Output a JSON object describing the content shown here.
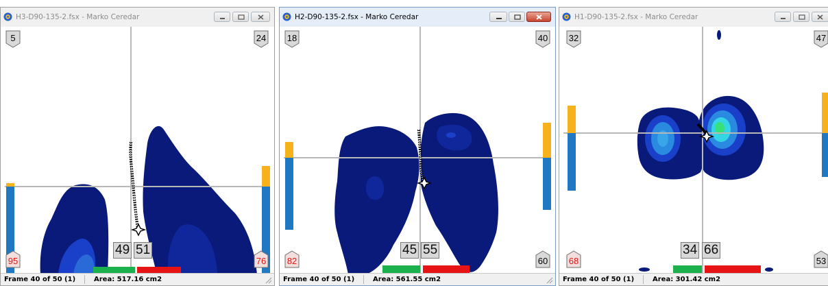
{
  "windows": [
    {
      "title": "H3-D90-135-2.fsx - Marko  Ceredar",
      "corners": {
        "top_left": "5",
        "top_right": "24",
        "bottom_left": "95",
        "bottom_right": "76"
      },
      "split": {
        "left": "49",
        "right": "51"
      },
      "status": {
        "frame": "Frame 40 of 50 (1)",
        "area": "Area: 517.16 cm2"
      }
    },
    {
      "title": "H2-D90-135-2.fsx - Marko Ceredar",
      "corners": {
        "top_left": "18",
        "top_right": "40",
        "bottom_left": "82",
        "bottom_right": "60"
      },
      "split": {
        "left": "45",
        "right": "55"
      },
      "status": {
        "frame": "Frame 40 of 50 (1)",
        "area": "Area: 561.55 cm2"
      }
    },
    {
      "title": "H1-D90-135-2.fsx - Marko  Ceredar",
      "corners": {
        "top_left": "32",
        "top_right": "47",
        "bottom_left": "68",
        "bottom_right": "53"
      },
      "split": {
        "left": "34",
        "right": "66"
      },
      "status": {
        "frame": "Frame 40 of 50 (1)",
        "area": "Area: 301.42 cm2"
      }
    }
  ],
  "colors": {
    "pressure_dark": "#0a1a7a",
    "pressure_mid": "#1a3fc8",
    "pressure_light": "#2a8ae0",
    "pressure_cyan": "#34d6e6",
    "pressure_green": "#38e07a",
    "bar_orange": "#f5b21c",
    "bar_blue": "#1f78c1",
    "green_bar": "#1db14e",
    "red_bar": "#e61414",
    "red_text": "#e61414",
    "crosshair": "#b8b8b8"
  },
  "icons": [
    "app-icon",
    "minimize-icon",
    "maximize-icon",
    "close-icon",
    "resize-grip-icon",
    "cop-marker-icon"
  ]
}
